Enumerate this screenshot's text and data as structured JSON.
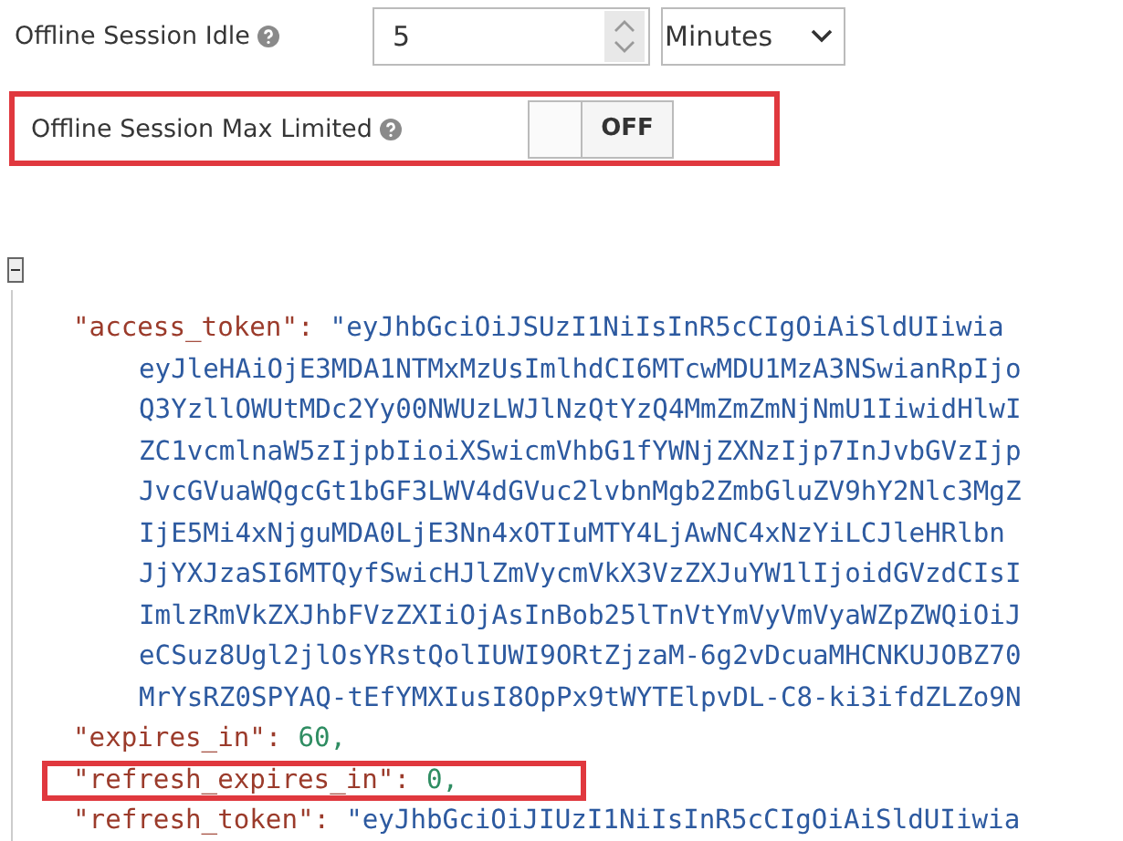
{
  "settings": [
    {
      "label": "Offline Session Idle",
      "kind": "number",
      "value": "5",
      "unit": "Minutes",
      "highlighted": false
    },
    {
      "label": "Offline Session Max Limited",
      "kind": "toggle",
      "on": false,
      "state_text": "OFF",
      "highlighted": true
    }
  ],
  "json_view": {
    "entries": [
      {
        "key": "\"access_token\":",
        "kind": "string",
        "highlighted": false,
        "lines": [
          "\"eyJhbGciOiJSUzI1NiIsInR5cCIgOiAiSldUIiwia",
          "eyJleHAiOjE3MDA1NTMxMzUsImlhdCI6MTcwMDU1MzA3NSwianRpIjo",
          "Q3YzllOWUtMDc2Yy00NWUzLWJlNzQtYzQ4MmZmZmNjNmU1IiwidHlwI",
          "ZC1vcmlnaW5zIjpbIioiXSwicmVhbG1fYWNjZXNzIjp7InJvbGVzIjp",
          "JvcGVuaWQgcGt1bGF3LWV4dGVuc2lvbnMgb2ZmbGluZV9hY2Nlc3MgZ",
          "IjE5Mi4xNjguMDA0LjE3Nn4xOTIuMTY4LjAwNC4xNzYiLCJleHRlbn",
          "JjYXJzaSI6MTQyfSwicHJlZmVycmVkX3VzZXJuYW1lIjoidGVzdCIsI",
          "ImlzRmVkZXJhbFVzZXIiOjAsInBob25lTnVtYmVyVmVyaWZpZWQiOiJ",
          "eCSuz8Ugl2jlOsYRstQolIUWI9ORtZjzaM-6g2vDcuaMHCNKUJOBZ70",
          "MrYsRZ0SPYAQ-tEfYMXIusI8OpPx9tWYTElpvDL-C8-ki3ifdZLZo9N"
        ]
      },
      {
        "key": "\"expires_in\":",
        "kind": "number",
        "highlighted": false,
        "lines": [
          "60,"
        ]
      },
      {
        "key": "\"refresh_expires_in\":",
        "kind": "number",
        "highlighted": true,
        "lines": [
          "0,"
        ]
      },
      {
        "key": "\"refresh_token\":",
        "kind": "string",
        "highlighted": false,
        "lines": [
          "\"eyJhbGciOiJIUzI1NiIsInR5cCIgOiAiSldUIiwia"
        ]
      }
    ]
  }
}
